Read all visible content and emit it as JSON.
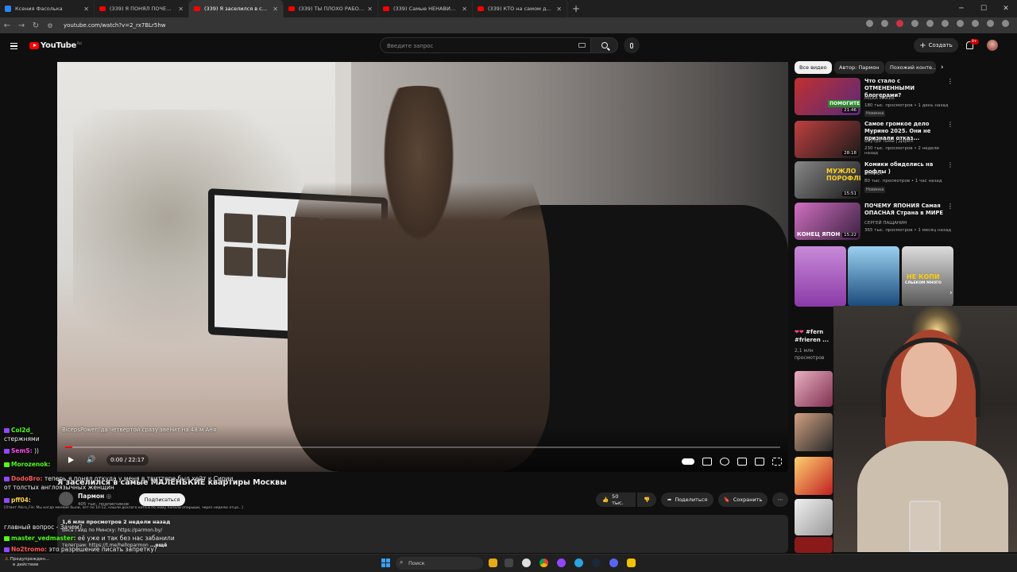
{
  "browser": {
    "tabs": [
      {
        "title": "Ксения Фасолька",
        "favicon": "vk"
      },
      {
        "title": "(339) Я ПОНЯЛ ПОЧЕМУ ВЕГАН...",
        "favicon": "youtube"
      },
      {
        "title": "(339) Я заселился в самые МА...",
        "favicon": "youtube",
        "active": true
      },
      {
        "title": "(339) ТЫ ПЛОХО РАБОТАЕШЬ...",
        "favicon": "youtube"
      },
      {
        "title": "(339) Самые НЕНАВИСТНЫЕ п...",
        "favicon": "youtube"
      },
      {
        "title": "(339) КТО на самом деле УБИЛ...",
        "favicon": "youtube"
      }
    ],
    "url": "youtube.com/watch?v=2_rx7BLr5hw"
  },
  "youtube": {
    "logo_text": "YouTube",
    "region": "RU",
    "search_placeholder": "Введите запрос",
    "create_label": "Создать",
    "notif_count": "9+"
  },
  "player": {
    "time": "0:00 / 22:17",
    "progress_fraction": 0.01,
    "caption_overlay": "BicepsPower: да четвертой сразу звенит на 48 м Аня"
  },
  "video": {
    "title": "Я заселился в самые МАЛЕНЬКИЕ квартиры Москвы",
    "channel": "Пармон",
    "subs": "405 тыс. подписчиков",
    "subscribe": "Подписаться",
    "likes": "50 тыс.",
    "share": "Поделиться",
    "save": "Сохранить",
    "meta": "1,6 млн просмотров  2 недели назад",
    "desc_line1": "Весь гайд по Минску: https://parmon.by/",
    "desc_link1": "https://parmon.by/",
    "desc_line2": "телеграм: https://t.me/helloparmon",
    "more": "...ещё"
  },
  "sidebar": {
    "chips": [
      "Все видео",
      "Автор: Пармон",
      "Похожий конте..."
    ],
    "recs": [
      {
        "title": "Что стало с ОТМЕНЕННЫМИ блогерами?",
        "channel": "MILKA MAKER",
        "views": "180 тыс. просмотров • 1 день назад",
        "badge": "Новинка",
        "duration": "21:46",
        "color": "#7a3b8f"
      },
      {
        "title": "Самое громкое дело Мурино 2025. Они не признали отказ...",
        "channel": "Внутри Тьмы | Дэрин",
        "views": "230 тыс. просмотров • 2 недели назад",
        "badge": "",
        "duration": "28:18",
        "color": "#5c2a2a"
      },
      {
        "title": "Комики обиделись на рофлы )",
        "channel": "SHAPKA",
        "views": "80 тыс. просмотров • 1 час назад",
        "badge": "Новинка",
        "duration": "15:51",
        "color": "#3d3d3d"
      },
      {
        "title": "ПОЧЕМУ ЯПОНИЯ Самая ОПАСНАЯ Страна в МИРЕ",
        "channel": "СЕРГЕЙ ПАЩАНИН",
        "views": "365 тыс. просмотров • 1 месяц назад",
        "badge": "",
        "duration": "15:22",
        "color": "#8a3a7a"
      }
    ],
    "thumb_texts": [
      "ПОМОГИТЕ",
      "МУЖЛО ПОРОФЛИЛ",
      "КОНЕЦ ЯПОН"
    ],
    "shorts_label": "#fern #frieren ...",
    "shorts_views": "2,1 млн просмотров",
    "shorts_texts": [
      "НЕ КОПИ",
      "СЛЬЕКОМ МНОГО"
    ]
  },
  "chat": [
    {
      "user": "Col2d_",
      "text": "",
      "color": "u-g",
      "tag": "twitch"
    },
    {
      "user": "",
      "text": "стержнями",
      "color": "",
      "tag": ""
    },
    {
      "user": "SemS:",
      "text": "))",
      "color": "u-p",
      "tag": "twitch"
    },
    {
      "user": "Morozenok:",
      "text": "",
      "color": "u-g",
      "tag": "kick"
    },
    {
      "user": "DodoBro:",
      "text": "теперь я понял откуда у меня в твиттере был хейт к Сирии",
      "color": "u-r",
      "tag": "twitch"
    },
    {
      "user": "",
      "text": "от толстых англоязычных женщин",
      "color": "",
      "tag": ""
    },
    {
      "user": "pff04:",
      "text": "",
      "color": "u-y",
      "tag": "twitch"
    },
    {
      "user": "",
      "text": "[Ответ Akira_Fin: Мы когда мелкие были, лет по 10-12, нашли дохлого кота в по ному попали опарыши, через неделю отца...]",
      "color": "",
      "tag": "small"
    },
    {
      "user": "",
      "text": "главный вопрос - Зачем?",
      "color": "",
      "tag": ""
    },
    {
      "user": "master_vedmaster:",
      "text": "её уже и так без нас забанили",
      "color": "u-g",
      "tag": "kick"
    },
    {
      "user": "No2tromo:",
      "text": "это разрешение писать запретку?",
      "color": "u-r",
      "tag": "twitch"
    }
  ],
  "taskbar": {
    "search_label": "Поиск",
    "weather": "Предупрежден...",
    "weather_sub": "в действии"
  }
}
